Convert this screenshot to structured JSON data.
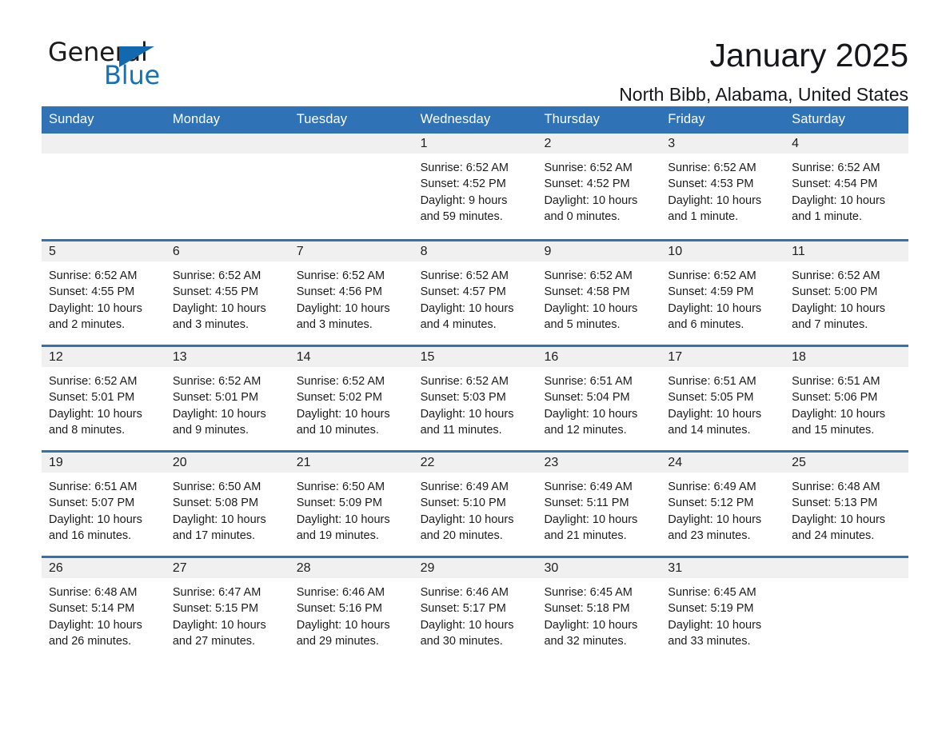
{
  "brand": {
    "word_one": "General",
    "word_two": "Blue",
    "triangle_icon": "brand-triangle-icon",
    "accent_color": "#1172bd"
  },
  "header": {
    "title": "January 2025",
    "subtitle": "North Bibb, Alabama, United States"
  },
  "calendar": {
    "header_bg_color": "#2f72b5",
    "day_band_color": "#f0f0f0",
    "weekdays": [
      "Sunday",
      "Monday",
      "Tuesday",
      "Wednesday",
      "Thursday",
      "Friday",
      "Saturday"
    ],
    "weeks": [
      [
        {
          "day": "",
          "sunrise": "",
          "sunset": "",
          "daylight_line1": "",
          "daylight_line2": ""
        },
        {
          "day": "",
          "sunrise": "",
          "sunset": "",
          "daylight_line1": "",
          "daylight_line2": ""
        },
        {
          "day": "",
          "sunrise": "",
          "sunset": "",
          "daylight_line1": "",
          "daylight_line2": ""
        },
        {
          "day": "1",
          "sunrise": "Sunrise: 6:52 AM",
          "sunset": "Sunset: 4:52 PM",
          "daylight_line1": "Daylight: 9 hours",
          "daylight_line2": "and 59 minutes."
        },
        {
          "day": "2",
          "sunrise": "Sunrise: 6:52 AM",
          "sunset": "Sunset: 4:52 PM",
          "daylight_line1": "Daylight: 10 hours",
          "daylight_line2": "and 0 minutes."
        },
        {
          "day": "3",
          "sunrise": "Sunrise: 6:52 AM",
          "sunset": "Sunset: 4:53 PM",
          "daylight_line1": "Daylight: 10 hours",
          "daylight_line2": "and 1 minute."
        },
        {
          "day": "4",
          "sunrise": "Sunrise: 6:52 AM",
          "sunset": "Sunset: 4:54 PM",
          "daylight_line1": "Daylight: 10 hours",
          "daylight_line2": "and 1 minute."
        }
      ],
      [
        {
          "day": "5",
          "sunrise": "Sunrise: 6:52 AM",
          "sunset": "Sunset: 4:55 PM",
          "daylight_line1": "Daylight: 10 hours",
          "daylight_line2": "and 2 minutes."
        },
        {
          "day": "6",
          "sunrise": "Sunrise: 6:52 AM",
          "sunset": "Sunset: 4:55 PM",
          "daylight_line1": "Daylight: 10 hours",
          "daylight_line2": "and 3 minutes."
        },
        {
          "day": "7",
          "sunrise": "Sunrise: 6:52 AM",
          "sunset": "Sunset: 4:56 PM",
          "daylight_line1": "Daylight: 10 hours",
          "daylight_line2": "and 3 minutes."
        },
        {
          "day": "8",
          "sunrise": "Sunrise: 6:52 AM",
          "sunset": "Sunset: 4:57 PM",
          "daylight_line1": "Daylight: 10 hours",
          "daylight_line2": "and 4 minutes."
        },
        {
          "day": "9",
          "sunrise": "Sunrise: 6:52 AM",
          "sunset": "Sunset: 4:58 PM",
          "daylight_line1": "Daylight: 10 hours",
          "daylight_line2": "and 5 minutes."
        },
        {
          "day": "10",
          "sunrise": "Sunrise: 6:52 AM",
          "sunset": "Sunset: 4:59 PM",
          "daylight_line1": "Daylight: 10 hours",
          "daylight_line2": "and 6 minutes."
        },
        {
          "day": "11",
          "sunrise": "Sunrise: 6:52 AM",
          "sunset": "Sunset: 5:00 PM",
          "daylight_line1": "Daylight: 10 hours",
          "daylight_line2": "and 7 minutes."
        }
      ],
      [
        {
          "day": "12",
          "sunrise": "Sunrise: 6:52 AM",
          "sunset": "Sunset: 5:01 PM",
          "daylight_line1": "Daylight: 10 hours",
          "daylight_line2": "and 8 minutes."
        },
        {
          "day": "13",
          "sunrise": "Sunrise: 6:52 AM",
          "sunset": "Sunset: 5:01 PM",
          "daylight_line1": "Daylight: 10 hours",
          "daylight_line2": "and 9 minutes."
        },
        {
          "day": "14",
          "sunrise": "Sunrise: 6:52 AM",
          "sunset": "Sunset: 5:02 PM",
          "daylight_line1": "Daylight: 10 hours",
          "daylight_line2": "and 10 minutes."
        },
        {
          "day": "15",
          "sunrise": "Sunrise: 6:52 AM",
          "sunset": "Sunset: 5:03 PM",
          "daylight_line1": "Daylight: 10 hours",
          "daylight_line2": "and 11 minutes."
        },
        {
          "day": "16",
          "sunrise": "Sunrise: 6:51 AM",
          "sunset": "Sunset: 5:04 PM",
          "daylight_line1": "Daylight: 10 hours",
          "daylight_line2": "and 12 minutes."
        },
        {
          "day": "17",
          "sunrise": "Sunrise: 6:51 AM",
          "sunset": "Sunset: 5:05 PM",
          "daylight_line1": "Daylight: 10 hours",
          "daylight_line2": "and 14 minutes."
        },
        {
          "day": "18",
          "sunrise": "Sunrise: 6:51 AM",
          "sunset": "Sunset: 5:06 PM",
          "daylight_line1": "Daylight: 10 hours",
          "daylight_line2": "and 15 minutes."
        }
      ],
      [
        {
          "day": "19",
          "sunrise": "Sunrise: 6:51 AM",
          "sunset": "Sunset: 5:07 PM",
          "daylight_line1": "Daylight: 10 hours",
          "daylight_line2": "and 16 minutes."
        },
        {
          "day": "20",
          "sunrise": "Sunrise: 6:50 AM",
          "sunset": "Sunset: 5:08 PM",
          "daylight_line1": "Daylight: 10 hours",
          "daylight_line2": "and 17 minutes."
        },
        {
          "day": "21",
          "sunrise": "Sunrise: 6:50 AM",
          "sunset": "Sunset: 5:09 PM",
          "daylight_line1": "Daylight: 10 hours",
          "daylight_line2": "and 19 minutes."
        },
        {
          "day": "22",
          "sunrise": "Sunrise: 6:49 AM",
          "sunset": "Sunset: 5:10 PM",
          "daylight_line1": "Daylight: 10 hours",
          "daylight_line2": "and 20 minutes."
        },
        {
          "day": "23",
          "sunrise": "Sunrise: 6:49 AM",
          "sunset": "Sunset: 5:11 PM",
          "daylight_line1": "Daylight: 10 hours",
          "daylight_line2": "and 21 minutes."
        },
        {
          "day": "24",
          "sunrise": "Sunrise: 6:49 AM",
          "sunset": "Sunset: 5:12 PM",
          "daylight_line1": "Daylight: 10 hours",
          "daylight_line2": "and 23 minutes."
        },
        {
          "day": "25",
          "sunrise": "Sunrise: 6:48 AM",
          "sunset": "Sunset: 5:13 PM",
          "daylight_line1": "Daylight: 10 hours",
          "daylight_line2": "and 24 minutes."
        }
      ],
      [
        {
          "day": "26",
          "sunrise": "Sunrise: 6:48 AM",
          "sunset": "Sunset: 5:14 PM",
          "daylight_line1": "Daylight: 10 hours",
          "daylight_line2": "and 26 minutes."
        },
        {
          "day": "27",
          "sunrise": "Sunrise: 6:47 AM",
          "sunset": "Sunset: 5:15 PM",
          "daylight_line1": "Daylight: 10 hours",
          "daylight_line2": "and 27 minutes."
        },
        {
          "day": "28",
          "sunrise": "Sunrise: 6:46 AM",
          "sunset": "Sunset: 5:16 PM",
          "daylight_line1": "Daylight: 10 hours",
          "daylight_line2": "and 29 minutes."
        },
        {
          "day": "29",
          "sunrise": "Sunrise: 6:46 AM",
          "sunset": "Sunset: 5:17 PM",
          "daylight_line1": "Daylight: 10 hours",
          "daylight_line2": "and 30 minutes."
        },
        {
          "day": "30",
          "sunrise": "Sunrise: 6:45 AM",
          "sunset": "Sunset: 5:18 PM",
          "daylight_line1": "Daylight: 10 hours",
          "daylight_line2": "and 32 minutes."
        },
        {
          "day": "31",
          "sunrise": "Sunrise: 6:45 AM",
          "sunset": "Sunset: 5:19 PM",
          "daylight_line1": "Daylight: 10 hours",
          "daylight_line2": "and 33 minutes."
        },
        {
          "day": "",
          "sunrise": "",
          "sunset": "",
          "daylight_line1": "",
          "daylight_line2": ""
        }
      ]
    ]
  }
}
